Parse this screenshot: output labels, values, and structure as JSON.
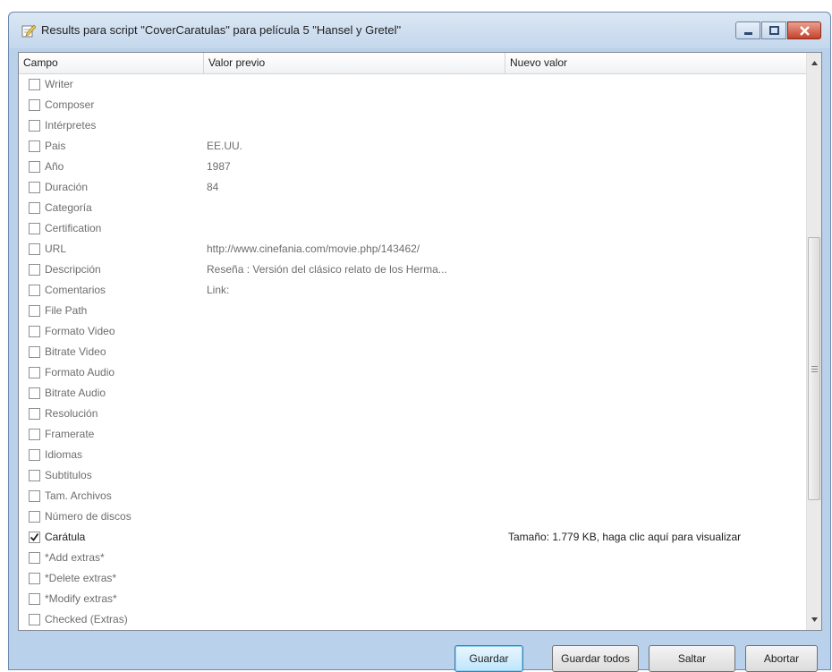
{
  "window": {
    "title": "Results para script \"CoverCaratulas\" para película 5 \"Hansel y Gretel\""
  },
  "columns": {
    "campo": "Campo",
    "previo": "Valor previo",
    "nuevo": "Nuevo valor"
  },
  "rows": [
    {
      "campo": "Writer",
      "checked": false,
      "previo": "",
      "nuevo": ""
    },
    {
      "campo": "Composer",
      "checked": false,
      "previo": "",
      "nuevo": ""
    },
    {
      "campo": "Intérpretes",
      "checked": false,
      "previo": "",
      "nuevo": ""
    },
    {
      "campo": "Pais",
      "checked": false,
      "previo": "EE.UU.",
      "nuevo": ""
    },
    {
      "campo": "Año",
      "checked": false,
      "previo": "1987",
      "nuevo": ""
    },
    {
      "campo": "Duración",
      "checked": false,
      "previo": "84",
      "nuevo": ""
    },
    {
      "campo": "Categoría",
      "checked": false,
      "previo": "",
      "nuevo": ""
    },
    {
      "campo": "Certification",
      "checked": false,
      "previo": "",
      "nuevo": ""
    },
    {
      "campo": "URL",
      "checked": false,
      "previo": "http://www.cinefania.com/movie.php/143462/",
      "nuevo": ""
    },
    {
      "campo": "Descripción",
      "checked": false,
      "previo": "Reseña :  Versión del clásico relato de los Herma...",
      "nuevo": ""
    },
    {
      "campo": "Comentarios",
      "checked": false,
      "previo": "Link:",
      "nuevo": ""
    },
    {
      "campo": "File Path",
      "checked": false,
      "previo": "",
      "nuevo": ""
    },
    {
      "campo": "Formato Video",
      "checked": false,
      "previo": "",
      "nuevo": ""
    },
    {
      "campo": "Bitrate Video",
      "checked": false,
      "previo": "",
      "nuevo": ""
    },
    {
      "campo": "Formato Audio",
      "checked": false,
      "previo": "",
      "nuevo": ""
    },
    {
      "campo": "Bitrate Audio",
      "checked": false,
      "previo": "",
      "nuevo": ""
    },
    {
      "campo": "Resolución",
      "checked": false,
      "previo": "",
      "nuevo": ""
    },
    {
      "campo": "Framerate",
      "checked": false,
      "previo": "",
      "nuevo": ""
    },
    {
      "campo": "Idiomas",
      "checked": false,
      "previo": "",
      "nuevo": ""
    },
    {
      "campo": "Subtitulos",
      "checked": false,
      "previo": "",
      "nuevo": ""
    },
    {
      "campo": "Tam. Archivos",
      "checked": false,
      "previo": "",
      "nuevo": ""
    },
    {
      "campo": "Número de discos",
      "checked": false,
      "previo": "",
      "nuevo": ""
    },
    {
      "campo": "Carátula",
      "checked": true,
      "previo": "",
      "nuevo": "Tamaño: 1.779 KB, haga clic aquí para visualizar"
    },
    {
      "campo": "*Add extras*",
      "checked": false,
      "previo": "",
      "nuevo": ""
    },
    {
      "campo": "*Delete extras*",
      "checked": false,
      "previo": "",
      "nuevo": ""
    },
    {
      "campo": "*Modify extras*",
      "checked": false,
      "previo": "",
      "nuevo": ""
    },
    {
      "campo": "Checked (Extras)",
      "checked": false,
      "previo": "",
      "nuevo": ""
    }
  ],
  "buttons": {
    "guardar": "Guardar",
    "guardar_todos": "Guardar todos",
    "saltar": "Saltar",
    "abortar": "Abortar"
  },
  "icons": {
    "title": "pencil-note-icon",
    "minimize": "minimize-icon",
    "maximize": "maximize-icon",
    "close": "close-icon"
  }
}
